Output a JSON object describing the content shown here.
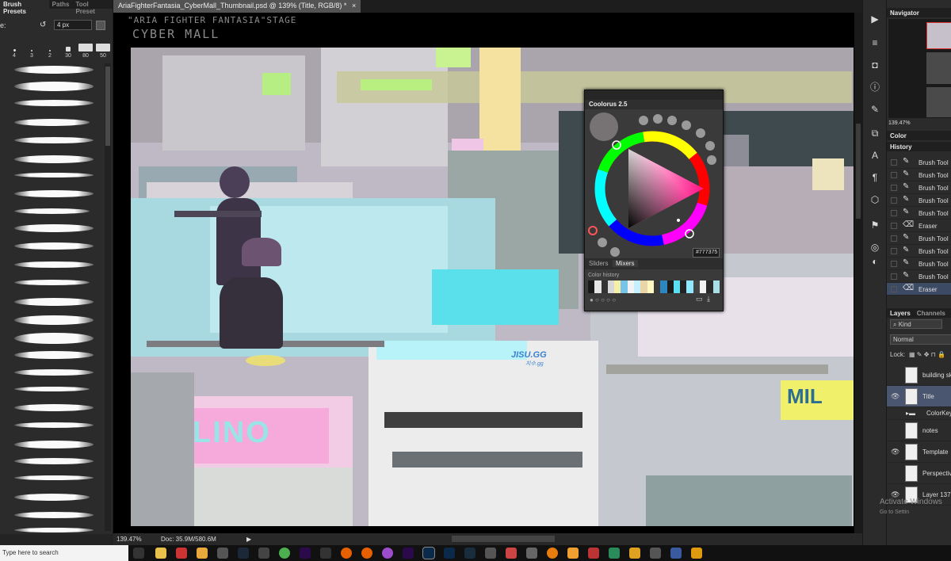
{
  "left_panel": {
    "tabs": [
      "Brush Presets",
      "Paths",
      "Tool Preset"
    ],
    "size_label": "e:",
    "size_value": "4 px",
    "preset_sizes": [
      "4",
      "3",
      "2",
      "30",
      "80",
      "50"
    ]
  },
  "document": {
    "tab_title": "AriaFighterFantasia_CyberMall_Thumbnail.psd @ 139% (Title, RGB/8) *",
    "close_icon": "×",
    "handwritten_line1": "\"ARIA FIGHTER FANTASIA\"STAGE",
    "handwritten_line2": "CYBER MALL",
    "art_signs": {
      "lino": "LINO",
      "jisu": "JISU.GG",
      "jisu_sub": "지수.gg",
      "mil": "MIL"
    }
  },
  "status": {
    "zoom": "139.47%",
    "doc": "Doc: 35.9M/580.6M"
  },
  "coolorus": {
    "title": "Coolorus 2.5",
    "hex_prefix": "#",
    "hex": "777375",
    "tabs": [
      "Sliders",
      "Mixers"
    ],
    "active_tab": "Mixers",
    "history_label": "Color history",
    "current_color": "#777375",
    "swatches": [
      "#1a1a1a",
      "#e5e5e5",
      "#333",
      "#d8d8d8",
      "#f5f0a6",
      "#78c4e8",
      "#f3f3f3",
      "#c6f0ff",
      "#e9d6a8",
      "#fff8c0",
      "#3b3b3b",
      "#2e86c1",
      "#1c1c1c",
      "#5ae0f0",
      "#222",
      "#8fe8ff",
      "#444",
      "#f2f2f2",
      "#2a2a2a",
      "#a9dfe6"
    ]
  },
  "right_panel": {
    "navigator_title": "Navigator",
    "nav_zoom": "139.47%",
    "color_tab": "Color",
    "history_tab": "History",
    "history_items": [
      "Brush Tool",
      "Brush Tool",
      "Brush Tool",
      "Brush Tool",
      "Brush Tool",
      "Eraser",
      "Brush Tool",
      "Brush Tool",
      "Brush Tool",
      "Brush Tool",
      "Eraser"
    ],
    "layers_tab": "Layers",
    "channels_tab": "Channels",
    "kind_label": "Kind",
    "blend_mode": "Normal",
    "lock_label": "Lock:",
    "layers": [
      {
        "name": "building sk",
        "visible": false
      },
      {
        "name": "Title",
        "visible": true
      },
      {
        "name": "ColorKey",
        "visible": false
      },
      {
        "name": "notes",
        "visible": false
      },
      {
        "name": "Template",
        "visible": true
      },
      {
        "name": "Perspective",
        "visible": false
      },
      {
        "name": "Layer 137",
        "visible": true
      }
    ]
  },
  "watermark": {
    "line1": "Activate Windows",
    "line2": "Go to Settin"
  },
  "taskbar": {
    "search_placeholder": "Type here to search"
  }
}
